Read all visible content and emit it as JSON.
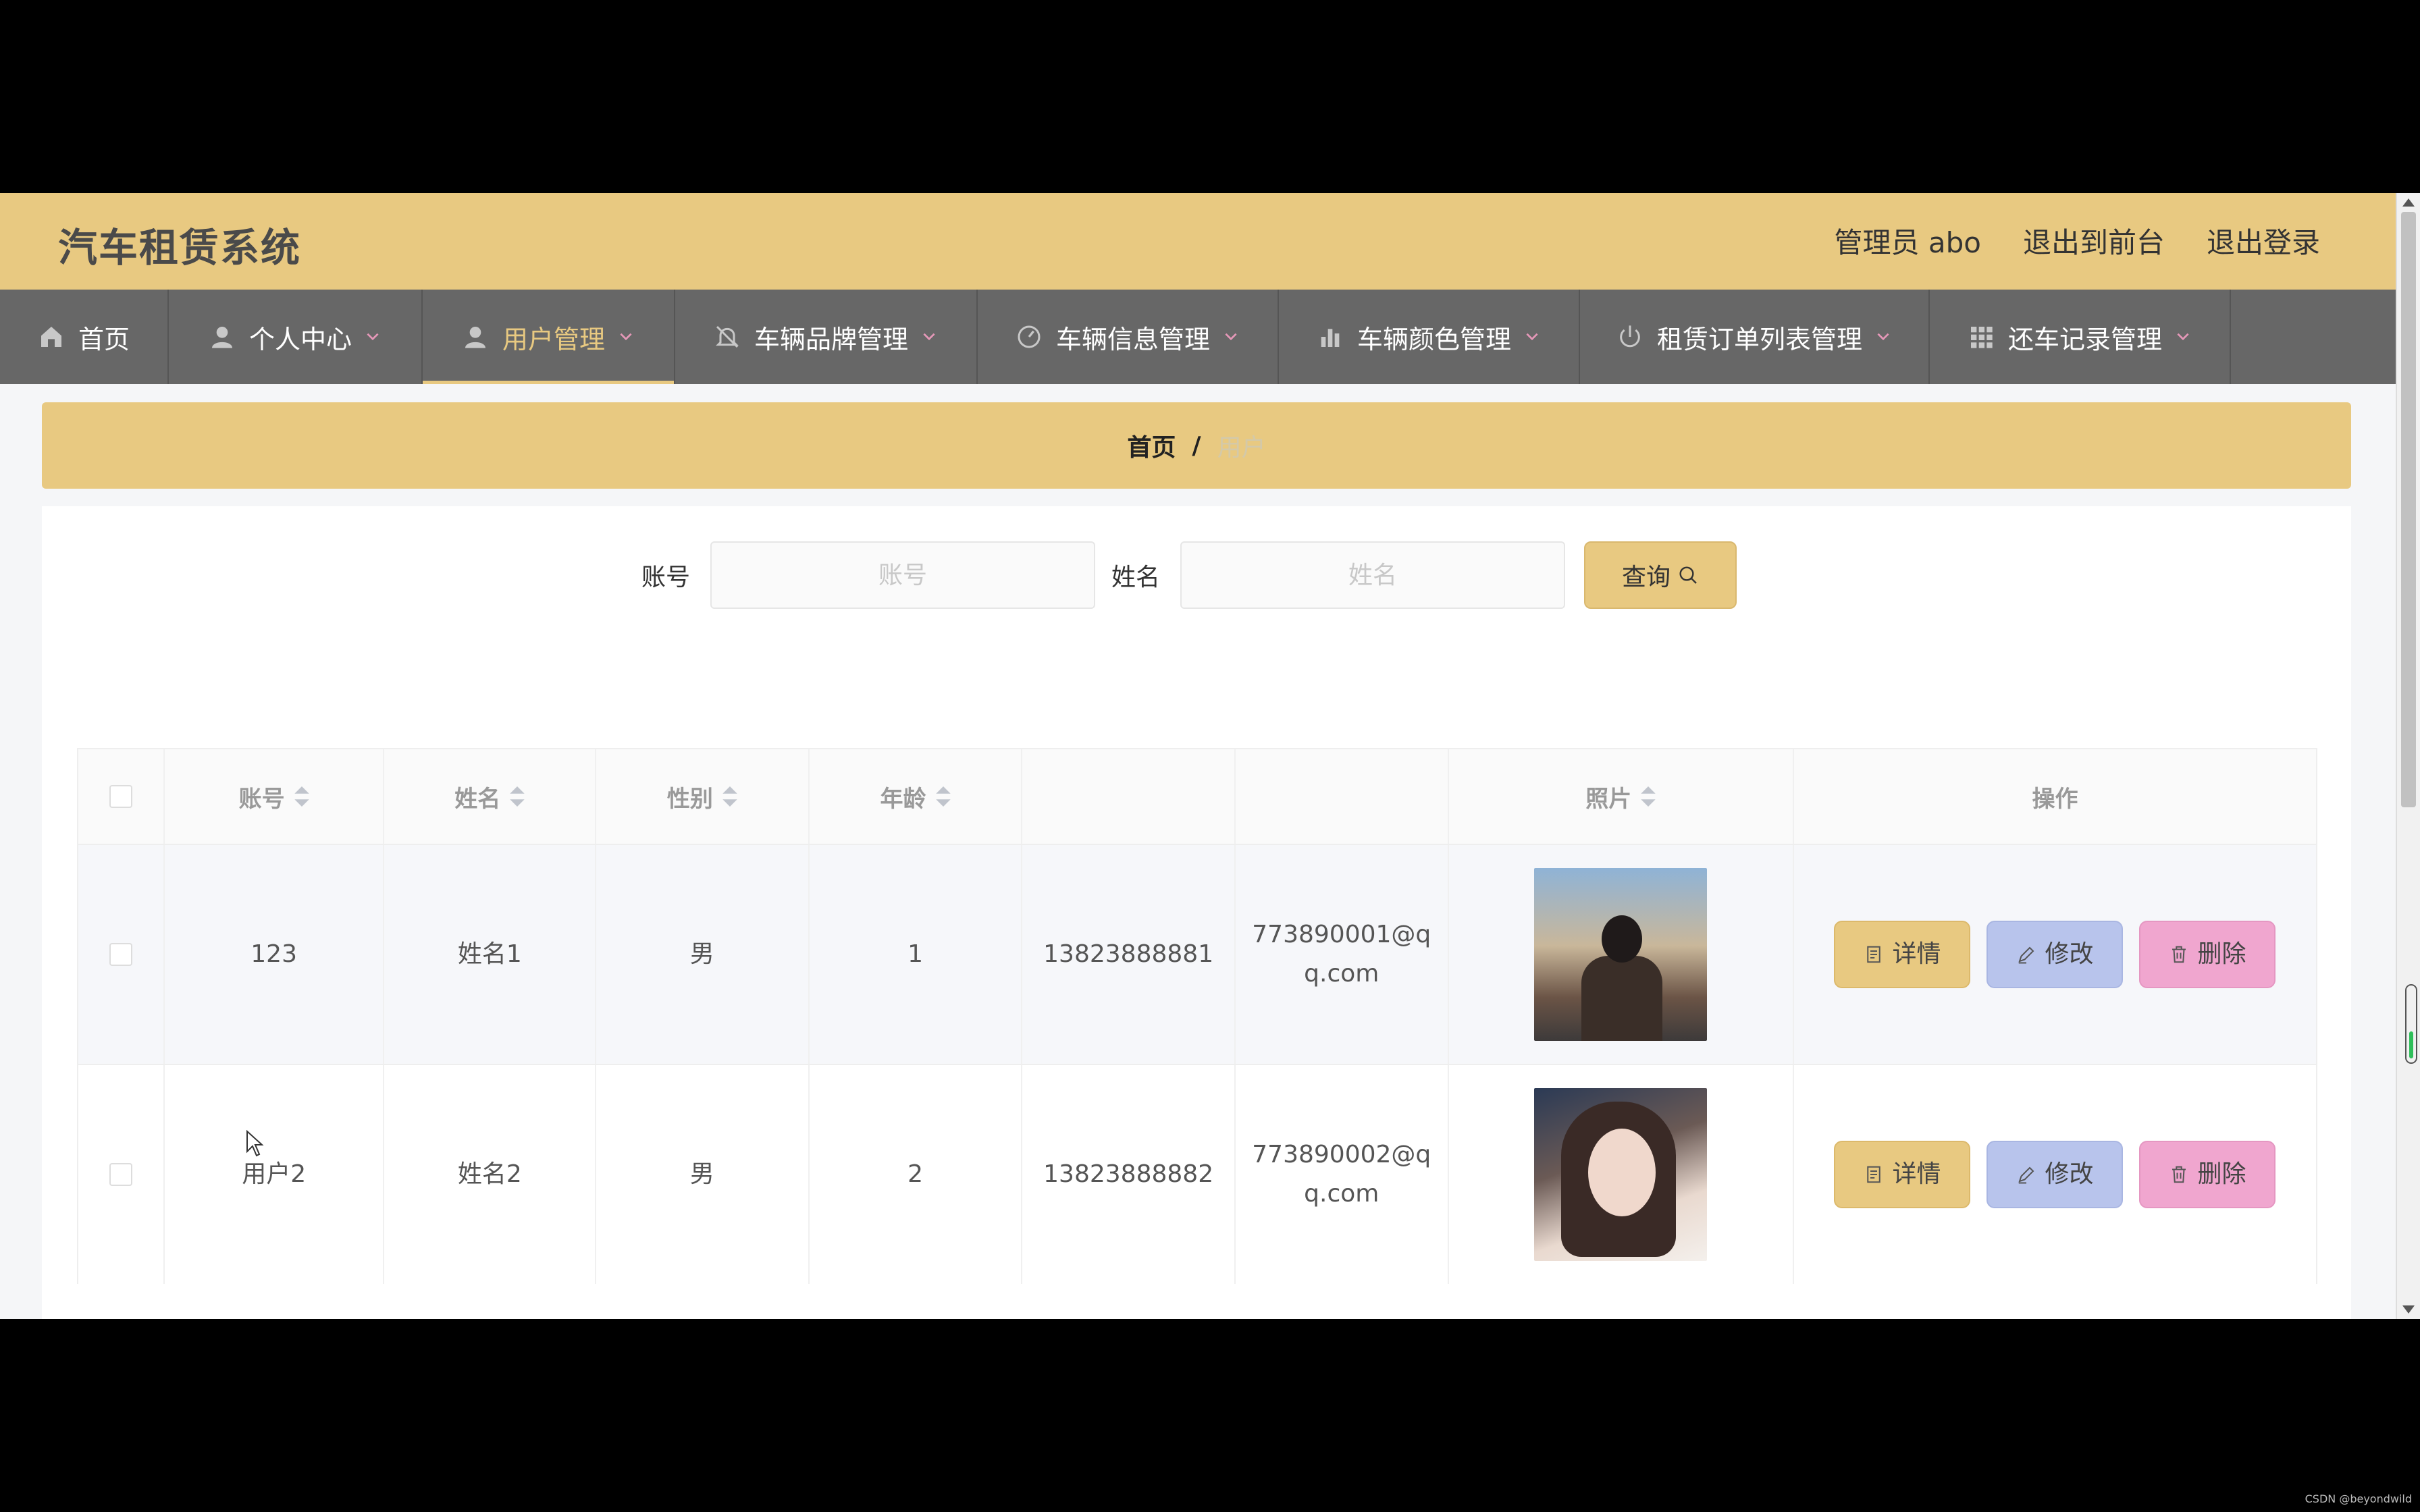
{
  "header": {
    "app_title": "汽车租赁系统",
    "user_label": "管理员 abo",
    "to_front_label": "退出到前台",
    "logout_label": "退出登录"
  },
  "nav": [
    {
      "label": "首页",
      "icon": "home-icon",
      "has_dropdown": false,
      "active": false
    },
    {
      "label": "个人中心",
      "icon": "user-icon",
      "has_dropdown": true,
      "active": false
    },
    {
      "label": "用户管理",
      "icon": "user-icon",
      "has_dropdown": true,
      "active": true
    },
    {
      "label": "车辆品牌管理",
      "icon": "bell-off-icon",
      "has_dropdown": true,
      "active": false
    },
    {
      "label": "车辆信息管理",
      "icon": "gauge-icon",
      "has_dropdown": true,
      "active": false
    },
    {
      "label": "车辆颜色管理",
      "icon": "bar-chart-icon",
      "has_dropdown": true,
      "active": false
    },
    {
      "label": "租赁订单列表管理",
      "icon": "power-icon",
      "has_dropdown": true,
      "active": false
    },
    {
      "label": "还车记录管理",
      "icon": "grid-icon",
      "has_dropdown": true,
      "active": false
    }
  ],
  "breadcrumb": {
    "home": "首页",
    "separator": "/",
    "current": "用户"
  },
  "search": {
    "account_label": "账号",
    "account_placeholder": "账号",
    "account_value": "",
    "name_label": "姓名",
    "name_placeholder": "姓名",
    "name_value": "",
    "button_label": "查询"
  },
  "table": {
    "columns": [
      "账号",
      "姓名",
      "性别",
      "年龄",
      "",
      "",
      "照片",
      "操作"
    ],
    "rows": [
      {
        "account": "123",
        "name": "姓名1",
        "gender": "男",
        "age": "1",
        "phone": "13823888881",
        "email_line1": "773890001@q",
        "email_line2": "q.com",
        "photo": "portrait-man"
      },
      {
        "account": "用户2",
        "name": "姓名2",
        "gender": "男",
        "age": "2",
        "phone": "13823888882",
        "email_line1": "773890002@q",
        "email_line2": "q.com",
        "photo": "portrait-woman"
      }
    ],
    "actions": {
      "detail": "详情",
      "edit": "修改",
      "delete": "删除"
    }
  },
  "colors": {
    "accent": "#e8c981",
    "nav_bg": "#676767",
    "edit_btn": "#b8c4ec",
    "delete_btn": "#f0a6cf"
  },
  "watermark": "CSDN @beyondwild"
}
